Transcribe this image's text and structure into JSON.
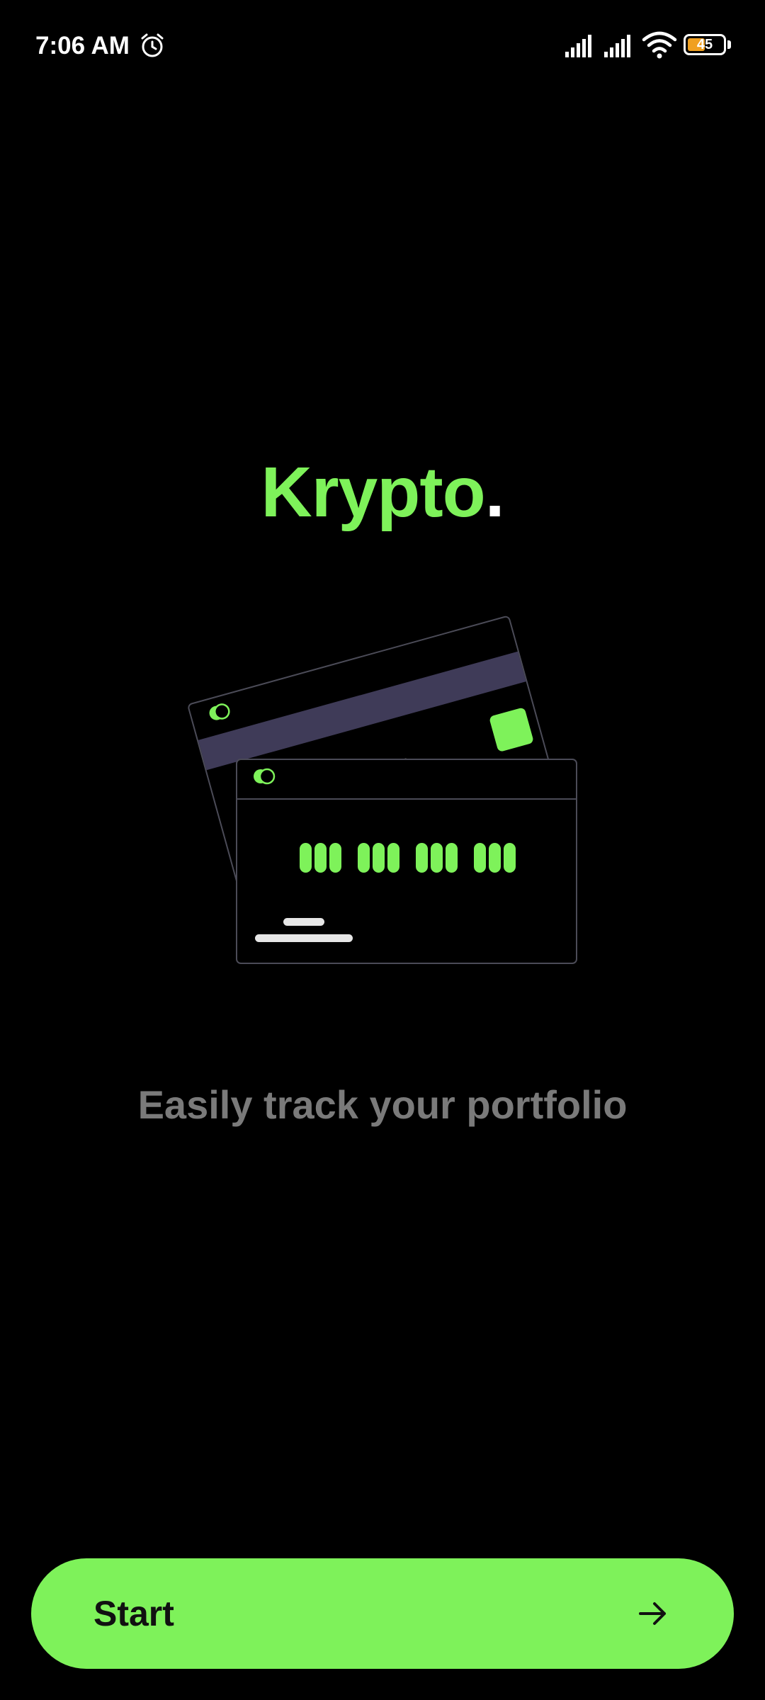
{
  "status_bar": {
    "time": "7:06 AM",
    "battery_level": "45",
    "battery_percent": 45,
    "icons": [
      "alarm-icon",
      "signal-icon",
      "signal-icon",
      "wifi-icon",
      "battery-icon"
    ]
  },
  "brand": {
    "name": "Krypto",
    "dot": "."
  },
  "illustration": {
    "icon": "credit-cards-illustration"
  },
  "tagline": "Easily track your portfolio",
  "start_button": {
    "label": "Start",
    "icon": "arrow-right-icon"
  },
  "colors": {
    "background": "#000000",
    "accent": "#7ef25a",
    "tagline": "#7a7a7a",
    "card_stripe": "#3f3b58"
  }
}
